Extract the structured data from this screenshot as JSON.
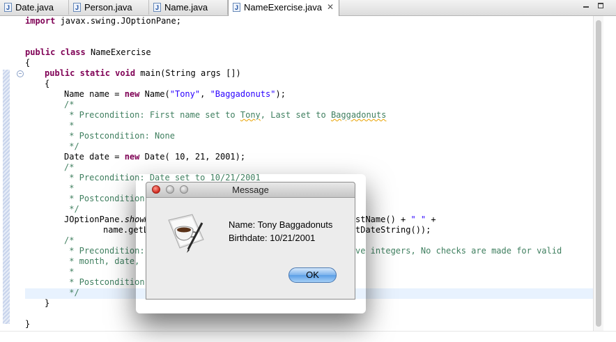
{
  "tabs": [
    {
      "label": "Date.java",
      "icon": "java-file-icon",
      "active": false
    },
    {
      "label": "Person.java",
      "icon": "java-file-icon",
      "active": false
    },
    {
      "label": "Name.java",
      "icon": "java-file-icon",
      "active": false
    },
    {
      "label": "NameExercise.java",
      "icon": "java-file-icon",
      "active": true
    }
  ],
  "code": {
    "l1a": "import",
    "l1b": " javax.swing.JOptionPane;",
    "l3a": "public",
    "l3b": " class",
    "l3c": " NameExercise",
    "l4": "{",
    "l5a": "public",
    "l5b": " static",
    "l5c": " void",
    "l5d": " main(String args [])",
    "l6": "{",
    "l7a": "Name name = ",
    "l7b": "new",
    "l7c": " Name(",
    "l7d": "\"Tony\"",
    "l7e": ", ",
    "l7f": "\"Baggadonuts\"",
    "l7g": ");",
    "l8": "/*",
    "l9a": " * Precondition: First name set to ",
    "l9b": "Tony",
    "l9c": ", Last set to ",
    "l9d": "Baggadonuts",
    "l10": " *",
    "l11": " * Postcondition: None",
    "l12": " */",
    "l13a": "Date date = ",
    "l13b": "new",
    "l13c": " Date( 10, 21, 2001);",
    "l14": "/*",
    "l15": " * Precondition: Date set to 10/21/2001",
    "l16": " *",
    "l17": " * Postcondition",
    "l18": " */",
    "l19a": "JOptionPane.",
    "l19b": "showM",
    "l19c": "stName() + ",
    "l19d": "\" \"",
    "l19e": " +",
    "l20a": "name.getL",
    "l20b": "tDateString());",
    "l21": "/*",
    "l22a": " * Precondition:",
    "l22b": "ve integers, No checks are made for valid",
    "l23": " * month, date,",
    "l24": " *",
    "l25": " * Postcondition",
    "l26": " */",
    "l27": "}",
    "l29": "}"
  },
  "dialog": {
    "title": "Message",
    "line1": "Name: Tony Baggadonuts",
    "line2": "Birthdate: 10/21/2001",
    "ok_label": "OK",
    "icon": "java-coffee-cup-icon"
  }
}
